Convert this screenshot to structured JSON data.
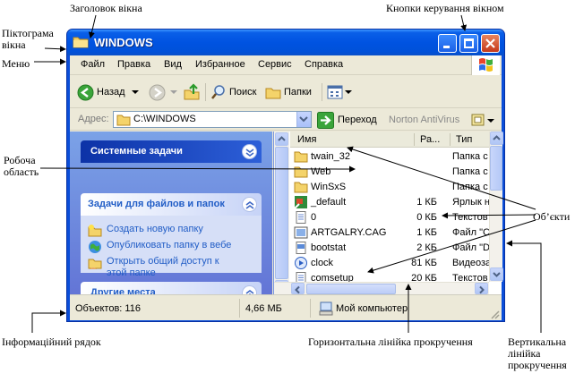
{
  "annotations": {
    "title_bar": "Заголовок вікна",
    "control_buttons": "Кнопки керування вікном",
    "window_icon": [
      "Піктограма",
      "вікна"
    ],
    "menu": "Меню",
    "work_area": [
      "Робоча",
      "область"
    ],
    "objects": "Об’єкти",
    "info_bar": "Інформаційний рядок",
    "h_scroll": "Горизонтальна лінійка прокручення",
    "v_scroll": [
      "Вертикальна",
      "лінійка",
      "прокручення"
    ]
  },
  "window": {
    "title": "WINDOWS",
    "menu": [
      "Файл",
      "Правка",
      "Вид",
      "Избранное",
      "Сервис",
      "Справка"
    ],
    "toolbar": {
      "back": "Назад",
      "search": "Поиск",
      "folders": "Папки"
    },
    "address": {
      "label": "Адрес:",
      "value": "C:\\WINDOWS",
      "go": "Переход",
      "norton": "Norton AntiVirus"
    },
    "taskpane": {
      "system_tasks": "Системные задачи",
      "file_tasks": "Задачи для файлов и папок",
      "tasks": [
        "Создать новую папку",
        "Опубликовать папку в вебе",
        "Открыть общий доступ к",
        "этой папке"
      ],
      "other_places": "Другие места"
    },
    "columns": {
      "name": "Имя",
      "size": "Ра...",
      "type": "Тип"
    },
    "files": [
      {
        "name": "twain_32",
        "size": "",
        "type": "Папка с",
        "icon": "folder-icon"
      },
      {
        "name": "Web",
        "size": "",
        "type": "Папка с",
        "icon": "folder-icon"
      },
      {
        "name": "WinSxS",
        "size": "",
        "type": "Папка с",
        "icon": "folder-icon"
      },
      {
        "name": "_default",
        "size": "1 КБ",
        "type": "Ярлык н",
        "icon": "shortcut-icon"
      },
      {
        "name": "0",
        "size": "0 КБ",
        "type": "Текстов",
        "icon": "text-file-icon"
      },
      {
        "name": "ARTGALRY.CAG",
        "size": "1 КБ",
        "type": "Файл \"С",
        "icon": "cag-file-icon"
      },
      {
        "name": "bootstat",
        "size": "2 КБ",
        "type": "Файл \"D",
        "icon": "dat-file-icon"
      },
      {
        "name": "clock",
        "size": "81 КБ",
        "type": "Видеоза",
        "icon": "video-file-icon"
      },
      {
        "name": "comsetup",
        "size": "20 КБ",
        "type": "Текстов",
        "icon": "text-file-icon"
      }
    ],
    "status": {
      "objects": "Объектов: 116",
      "size": "4,66 МБ",
      "location": "Мой компьютер"
    }
  },
  "colors": {
    "titlebar": "#0053e1",
    "taskpane": "#6f8edf",
    "link": "#215dc6",
    "face": "#ece9d8"
  }
}
